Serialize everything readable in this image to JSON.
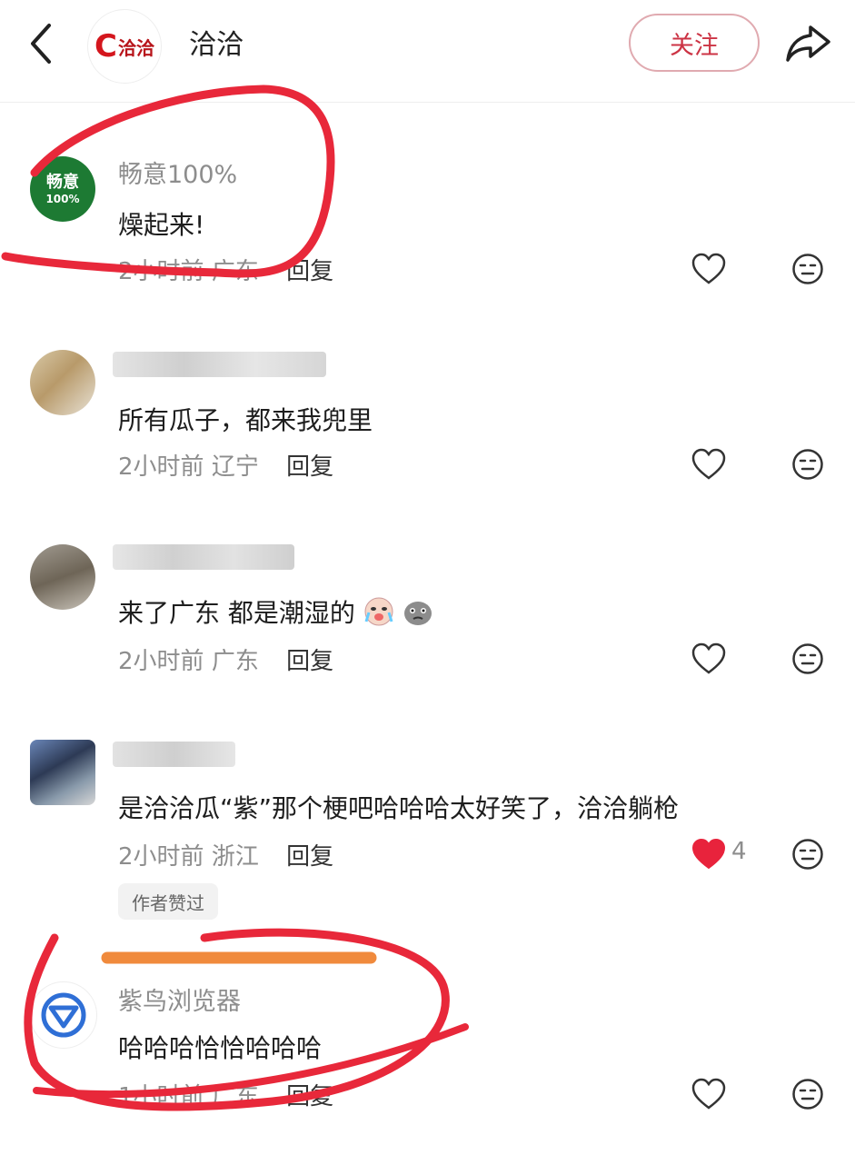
{
  "header": {
    "title": "洽洽",
    "logo_text": "洽洽",
    "follow_label": "关注",
    "back_icon": "chevron-left-icon",
    "share_icon": "share-arrow-icon"
  },
  "comments": [
    {
      "avatar_text_top": "畅意",
      "avatar_text_bottom": "100%",
      "name": "畅意100%",
      "text": "燥起来!",
      "time": "2小时前",
      "location": "广东",
      "reply": "回复",
      "liked": false
    },
    {
      "name": "",
      "text": "所有瓜子，都来我兜里",
      "time": "2小时前",
      "location": "辽宁",
      "reply": "回复",
      "liked": false
    },
    {
      "name": "",
      "text": "来了广东 都是潮湿的",
      "time": "2小时前",
      "location": "广东",
      "reply": "回复",
      "liked": false
    },
    {
      "name": "",
      "text": "是洽洽瓜“紫”那个梗吧哈哈哈太好笑了，洽洽躺枪",
      "time": "2小时前",
      "location": "浙江",
      "reply": "回复",
      "liked": true,
      "like_count": "4",
      "badge": "作者赞过"
    },
    {
      "name": "紫鸟浏览器",
      "text": "哈哈哈恰恰哈哈哈",
      "time": "1小时前",
      "location": "广东",
      "reply": "回复",
      "liked": false
    }
  ],
  "colors": {
    "accent": "#cc3344",
    "like_red": "#e8233c",
    "annotation_red": "#e8283a",
    "annotation_orange": "#f08a3c"
  }
}
